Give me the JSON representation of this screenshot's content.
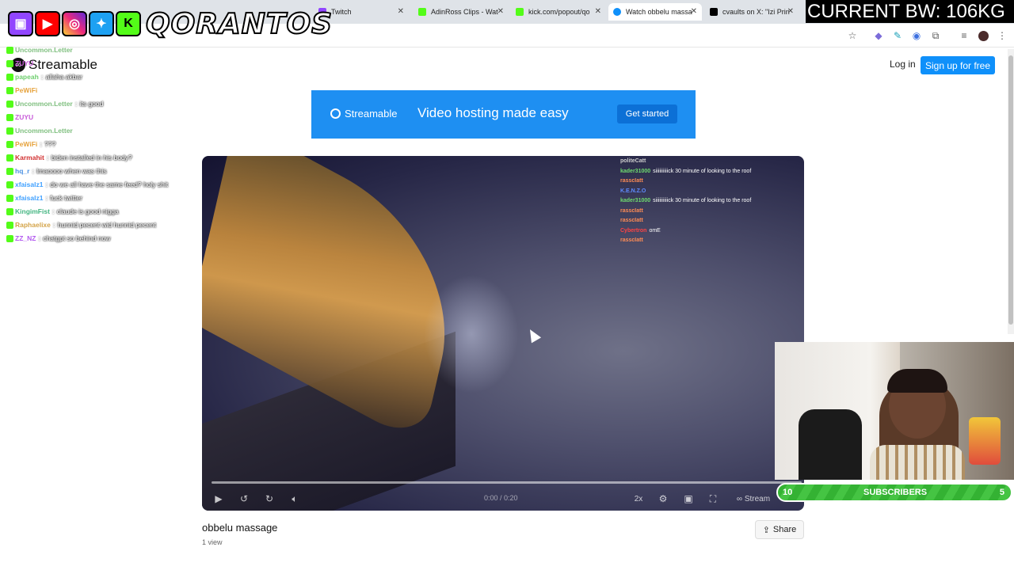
{
  "browser": {
    "tabs": [
      {
        "label": "Twitch",
        "color": "#9146ff"
      },
      {
        "label": "AdinRoss Clips - Wat",
        "color": "#53fc18"
      },
      {
        "label": "kick.com/popout/qo",
        "color": "#53fc18"
      },
      {
        "label": "Watch obbelu massa",
        "color": "#0f90fa",
        "active": true
      },
      {
        "label": "cvaults on X: \"Izi Prin",
        "color": "#000000"
      }
    ]
  },
  "overlay": {
    "brand": "QORANTOS",
    "social_icons": [
      "twitch-icon",
      "youtube-icon",
      "instagram-icon",
      "twitter-icon",
      "kick-icon"
    ],
    "bw_label": "CURRENT BW: 106KG",
    "subs_left": "10",
    "subs_label": "SUBSCRIBERS",
    "subs_right": "5",
    "chat": [
      {
        "user": "Uncommon.Letter",
        "color": "#7fbf7f",
        "msg": ""
      },
      {
        "user": "ZUYU",
        "color": "#c85bd9",
        "msg": ""
      },
      {
        "user": "papeah",
        "color": "#6fcf6f",
        "msg": "allaha akbar"
      },
      {
        "user": "PeWiFi",
        "color": "#e6a23c",
        "msg": ""
      },
      {
        "user": "Uncommon.Letter",
        "color": "#7fbf7f",
        "msg": "its good"
      },
      {
        "user": "ZUYU",
        "color": "#c85bd9",
        "msg": ""
      },
      {
        "user": "Uncommon.Letter",
        "color": "#7fbf7f",
        "msg": ""
      },
      {
        "user": "PeWiFi",
        "color": "#e6a23c",
        "msg": "???"
      },
      {
        "user": "Karmahit",
        "color": "#d23232",
        "msg": "biden installed in his body?"
      },
      {
        "user": "hq_r",
        "color": "#4a90e2",
        "msg": "lmaoooo when was this"
      },
      {
        "user": "xfaisalz1",
        "color": "#3fa0ff",
        "msg": "do we all have the same feed? holy shit"
      },
      {
        "user": "xfaisalz1",
        "color": "#3fa0ff",
        "msg": "fuck twitter"
      },
      {
        "user": "KingimFist",
        "color": "#43b581",
        "msg": "claude is good nigga"
      },
      {
        "user": "Raphaelixe",
        "color": "#d4a44a",
        "msg": "hunnid pecent wid hunnid pecent"
      },
      {
        "user": "ZZ_NZ",
        "color": "#b45cf0",
        "msg": "chatgpt so behind now"
      }
    ]
  },
  "site": {
    "logo": "Streamable",
    "login": "Log in",
    "signup": "Sign up for free",
    "banner_logo": "Streamable",
    "banner_tagline": "Video hosting made easy",
    "banner_cta": "Get started"
  },
  "video": {
    "title": "obbelu massage",
    "views": "1 view",
    "share_label": "Share",
    "time": "0:00 / 0:20",
    "speed": "2x",
    "progress": 0.0,
    "stream_chat": [
      {
        "user": "politeCatt",
        "color": "#cfcfcf",
        "msg": ""
      },
      {
        "user": "kader31000",
        "color": "#6fdc6f",
        "msg": "siiiiiiiiiick 30 minute of looking to the roof"
      },
      {
        "user": "rasscIatt",
        "color": "#ff8c55",
        "msg": ""
      },
      {
        "user": "K.E.N.Z.O",
        "color": "#5f8cff",
        "msg": ""
      },
      {
        "user": "kader31000",
        "color": "#6fdc6f",
        "msg": "siiiiiiiiiick 30 minute of looking to the roof"
      },
      {
        "user": "rasscIatt",
        "color": "#ff8c55",
        "msg": ""
      },
      {
        "user": "rasscIatt",
        "color": "#ff8c55",
        "msg": ""
      },
      {
        "user": "Cybertron",
        "color": "#ff4444",
        "msg": "omE"
      },
      {
        "user": "rasscIatt",
        "color": "#ff8c55",
        "msg": ""
      }
    ]
  }
}
